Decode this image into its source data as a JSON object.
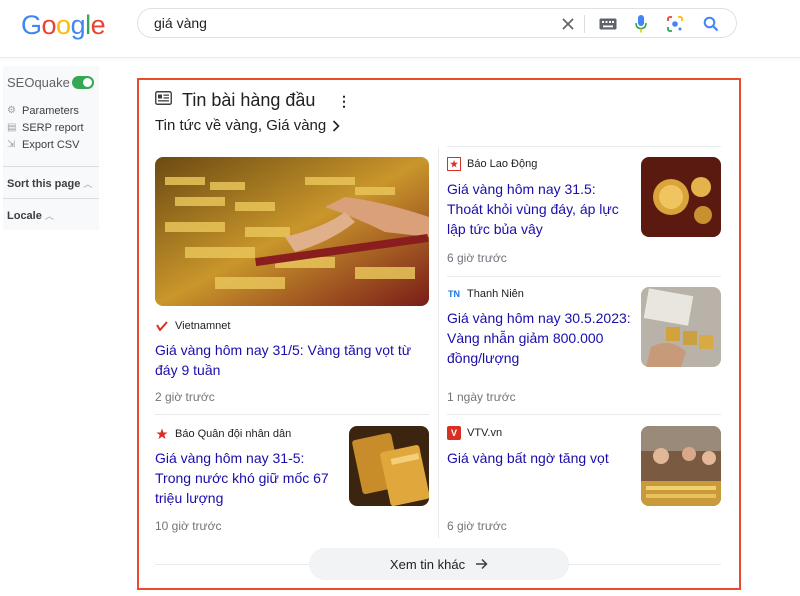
{
  "logo": {
    "letters": [
      "G",
      "o",
      "o",
      "g",
      "l",
      "e"
    ],
    "colors": [
      "#4285f4",
      "#ea4335",
      "#fbbc05",
      "#4285f4",
      "#34a853",
      "#ea4335"
    ]
  },
  "search": {
    "query": "giá vàng",
    "icons": [
      "close-icon",
      "keyboard-icon",
      "mic-icon",
      "lens-icon",
      "search-icon"
    ]
  },
  "seoquake": {
    "title": "SEOquake",
    "items": [
      {
        "label": "Parameters",
        "icon": "gear-icon"
      },
      {
        "label": "SERP report",
        "icon": "report-icon"
      },
      {
        "label": "Export CSV",
        "icon": "export-icon"
      }
    ],
    "sort_label": "Sort this page",
    "locale_label": "Locale"
  },
  "top_stories": {
    "title": "Tin bài hàng đầu",
    "subtitle": "Tin tức về vàng, Giá vàng",
    "border_color": "#ea4b2b",
    "featured": {
      "source": "Vietnamnet",
      "headline": "Giá vàng hôm nay 31/5: Vàng tăng vọt từ đáy 9 tuần",
      "time": "2 giờ trước"
    },
    "left_bottom": {
      "source": "Báo Quân đội nhân dân",
      "headline": "Giá vàng hôm nay 31-5: Trong nước khó giữ mốc 67 triệu lượng",
      "time": "10 giờ trước"
    },
    "right": [
      {
        "source": "Báo Lao Động",
        "headline": "Giá vàng hôm nay 31.5: Thoát khỏi vùng đáy, áp lực lập tức bủa vây",
        "time": "6 giờ trước"
      },
      {
        "source": "Thanh Niên",
        "headline": "Giá vàng hôm nay 30.5.2023: Vàng nhẫn giảm 800.000 đồng/lượng",
        "time": "1 ngày trước"
      },
      {
        "source": "VTV.vn",
        "headline": "Giá vàng bất ngờ tăng vọt",
        "time": "6 giờ trước"
      }
    ],
    "more_button": "Xem tin khác"
  }
}
